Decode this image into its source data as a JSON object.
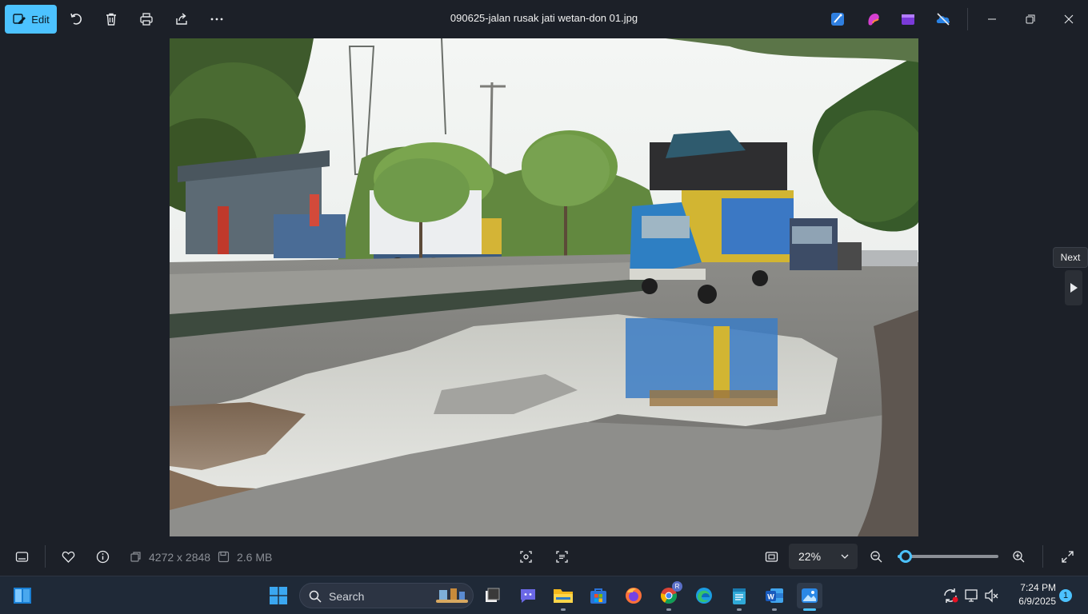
{
  "toolbar": {
    "edit_label": "Edit",
    "title": "090625-jalan rusak jati wetan-don 01.jpg"
  },
  "next": {
    "tooltip": "Next"
  },
  "info": {
    "dimensions": "4272 x 2848",
    "file_size": "2.6 MB",
    "zoom": "22%",
    "zoom_level": 0.08
  },
  "taskbar": {
    "search_label": "Search",
    "time": "7:24 PM",
    "date": "6/9/2025",
    "notification_count": "1",
    "chrome_profile_letter": "R"
  },
  "colors": {
    "accent": "#4cc2ff",
    "background": "#1c2028",
    "taskbar": "#1f2937"
  }
}
